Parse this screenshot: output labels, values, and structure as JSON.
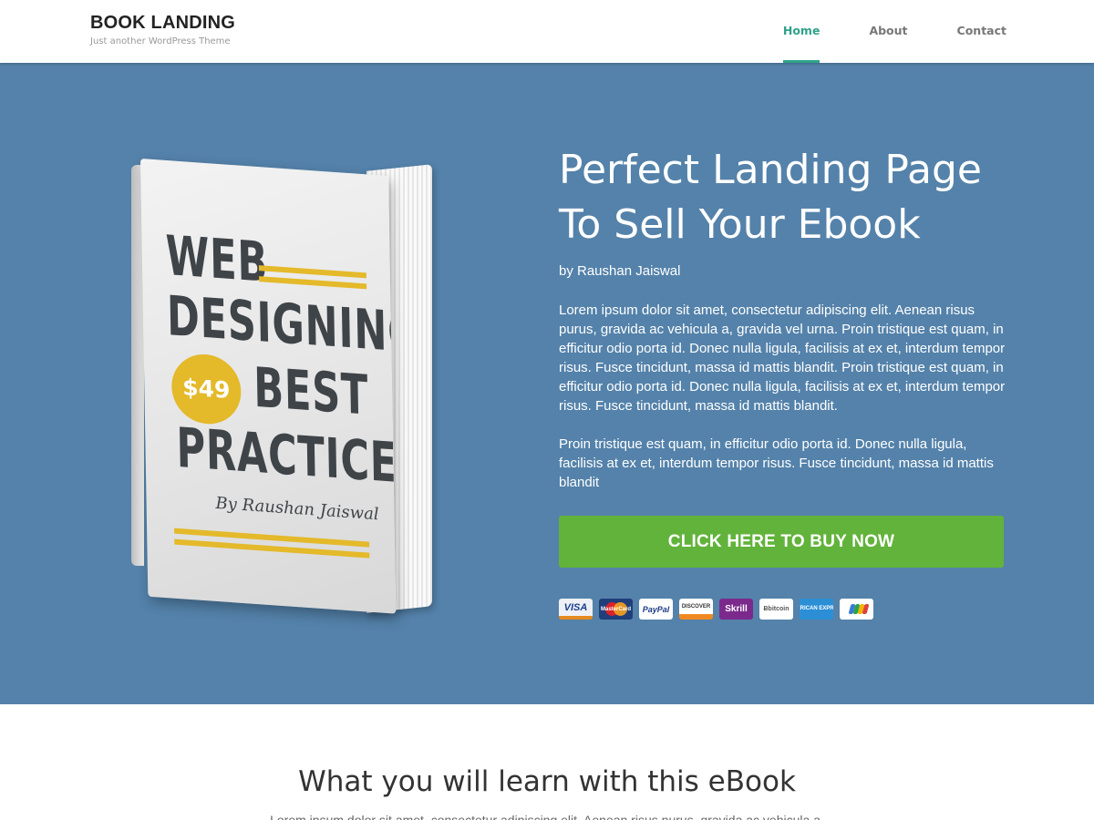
{
  "header": {
    "site_title": "BOOK LANDING",
    "tagline": "Just another WordPress Theme",
    "nav": [
      {
        "label": "Home",
        "active": true
      },
      {
        "label": "About",
        "active": false
      },
      {
        "label": "Contact",
        "active": false
      }
    ]
  },
  "colors": {
    "hero_background": "#5482aa",
    "accent": "#2fa28a",
    "buy_button": "#62b33b",
    "book_yellow": "#e4b92a"
  },
  "book_cover": {
    "line1": "WEB",
    "line2": "DESIGNING",
    "price": "$49",
    "line3": "BEST",
    "line4": "PRACTICES",
    "author": "By Raushan Jaiswal"
  },
  "hero": {
    "title_line1": "Perfect Landing Page",
    "title_line2": "To Sell Your Ebook",
    "author": "by Raushan Jaiswal",
    "paragraph1": "Lorem ipsum dolor sit amet, consectetur adipiscing elit. Aenean risus purus, gravida ac vehicula a, gravida vel urna. Proin tristique est quam, in efficitur odio porta id. Donec nulla ligula, facilisis at ex et, interdum tempor risus. Fusce tincidunt, massa id mattis blandit. Proin tristique est quam, in efficitur odio porta id. Donec nulla ligula, facilisis at ex et, interdum tempor risus. Fusce tincidunt, massa id mattis blandit.",
    "paragraph2": "Proin tristique est quam, in efficitur odio porta id. Donec nulla ligula, facilisis at ex et, interdum tempor risus. Fusce tincidunt, massa id mattis blandit",
    "buy_label": "CLICK HERE TO BUY NOW"
  },
  "payments": {
    "visa": "VISA",
    "mastercard": "MasterCard",
    "paypal": "PayPal",
    "discover": "DISCOVER",
    "skrill": "Skrill",
    "bitcoin": "Ƀbitcoin",
    "amex": "AMERICAN EXPRESS",
    "icons": [
      "visa-icon",
      "mastercard-icon",
      "paypal-icon",
      "discover-icon",
      "skrill-icon",
      "bitcoin-icon",
      "amex-icon",
      "google-wallet-icon"
    ]
  },
  "learn": {
    "title": "What you will learn with this eBook",
    "subtitle": "Lorem ipsum dolor sit amet, consectetur adipiscing elit. Aenean risus purus, gravida ac vehicula a."
  }
}
